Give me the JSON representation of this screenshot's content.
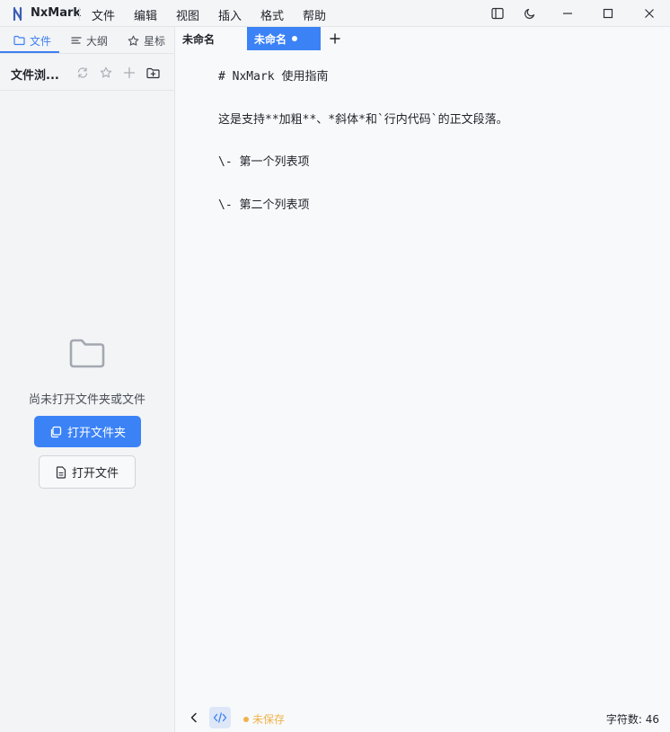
{
  "app": {
    "name": "NxMark"
  },
  "menu": [
    "文件",
    "编辑",
    "视图",
    "插入",
    "格式",
    "帮助"
  ],
  "sidebar": {
    "tabs": [
      {
        "label": "文件",
        "icon": "folder-icon",
        "active": true
      },
      {
        "label": "大纲",
        "icon": "outline-icon",
        "active": false
      },
      {
        "label": "星标",
        "icon": "star-icon",
        "active": false
      }
    ],
    "header_title": "文件浏...",
    "empty_text": "尚未打开文件夹或文件",
    "open_folder_label": "打开文件夹",
    "open_file_label": "打开文件"
  },
  "tabs": [
    {
      "label": "未命名",
      "active": false,
      "modified": false
    },
    {
      "label": "未命名",
      "active": true,
      "modified": true
    }
  ],
  "editor": {
    "lines": [
      "# NxMark 使用指南",
      "这是支持**加粗**、*斜体*和`行内代码`的正文段落。",
      "\\- 第一个列表项",
      "\\- 第二个列表项"
    ]
  },
  "status": {
    "save_state": "未保存",
    "char_count": "字符数: 46"
  },
  "colors": {
    "accent": "#3b82f6",
    "unsaved": "#f0b24a"
  }
}
